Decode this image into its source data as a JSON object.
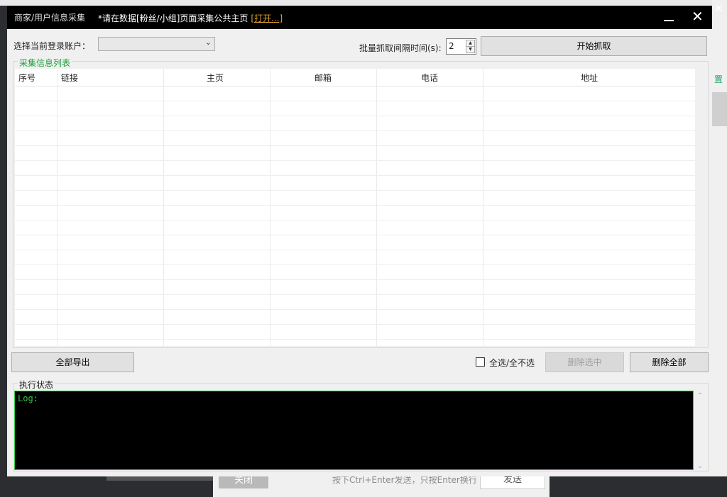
{
  "background": {
    "close_button": "关闭",
    "send_hint": "按下Ctrl+Enter发送，只按Enter换行",
    "send_button": "发送",
    "side_label": "置",
    "side_close": "×"
  },
  "dialog": {
    "title": "商家/用户信息采集",
    "notice": "*请在数据[粉丝/小组]页面采集公共主页",
    "open_link": "[打开...]",
    "minimize_icon": "minimize-icon",
    "close_icon": "close-icon",
    "close_glyph": "✕",
    "account_label": "选择当前登录账户：",
    "account_value": "",
    "interval_label": "批量抓取间隔时间(s):",
    "interval_value": "2",
    "start_button": "开始抓取",
    "list_group_title": "采集信息列表",
    "table": {
      "columns": [
        "序号",
        "链接",
        "主页",
        "邮箱",
        "电话",
        "地址"
      ],
      "rows": []
    },
    "export_button": "全部导出",
    "select_all_label": "全选/全不选",
    "select_all_checked": false,
    "delete_selected_button": "删除选中",
    "delete_all_button": "删除全部",
    "status_group_title": "执行状态",
    "log_text": "Log:"
  },
  "colors": {
    "accent_green": "#19a03a",
    "log_text": "#2ecc40",
    "link_orange": "#e0a030",
    "titlebar": "#000000"
  }
}
